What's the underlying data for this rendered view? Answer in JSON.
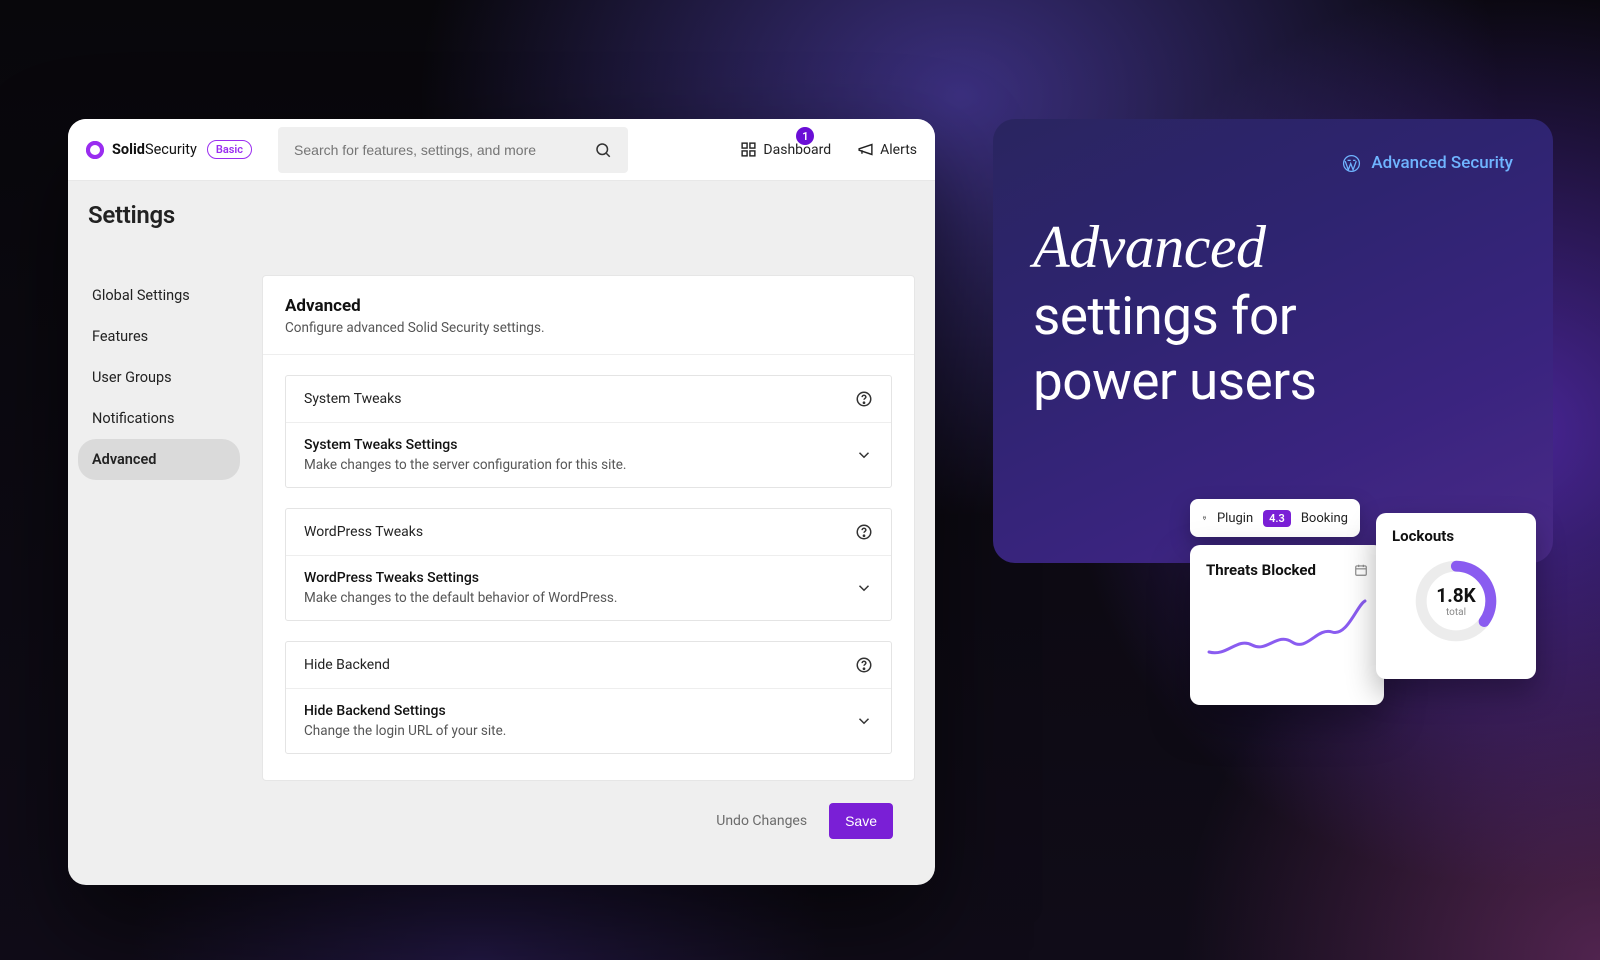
{
  "brand": {
    "name_bold": "Solid",
    "name_thin": "Security",
    "badge": "Basic"
  },
  "search": {
    "placeholder": "Search for features, settings, and more"
  },
  "nav": {
    "dashboard": "Dashboard",
    "alerts": "Alerts",
    "badge_count": "1"
  },
  "page_title": "Settings",
  "sidebar": {
    "items": [
      {
        "label": "Global Settings"
      },
      {
        "label": "Features"
      },
      {
        "label": "User Groups"
      },
      {
        "label": "Notifications"
      },
      {
        "label": "Advanced"
      }
    ],
    "active_index": 4
  },
  "panel": {
    "title": "Advanced",
    "subtitle": "Configure advanced Solid Security settings.",
    "sections": [
      {
        "title": "System Tweaks",
        "sub_title": "System Tweaks Settings",
        "sub_desc": "Make changes to the server configuration for this site."
      },
      {
        "title": "WordPress Tweaks",
        "sub_title": "WordPress Tweaks Settings",
        "sub_desc": "Make changes to the default behavior of WordPress."
      },
      {
        "title": "Hide Backend",
        "sub_title": "Hide Backend Settings",
        "sub_desc": "Change the login URL of your site."
      }
    ]
  },
  "footer": {
    "undo": "Undo Changes",
    "save": "Save"
  },
  "promo": {
    "top_label": "Advanced Security",
    "headline_emph": "Advanced",
    "headline_rest_1": "settings for",
    "headline_rest_2": "power users"
  },
  "stat_plugin": {
    "label": "Plugin",
    "version": "4.3",
    "extra": "Booking"
  },
  "stat_threats": {
    "title": "Threats Blocked"
  },
  "stat_lockouts": {
    "title": "Lockouts",
    "value": "1.8K",
    "sub": "total"
  }
}
